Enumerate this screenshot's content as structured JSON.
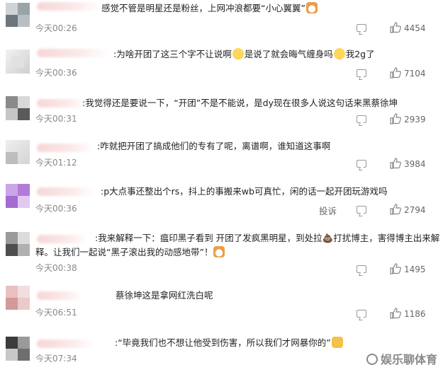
{
  "comments": [
    {
      "text": "感觉不管是明星还是粉丝，上网冲浪都要“小心翼翼”",
      "emoji_after": "cat",
      "time": "今天00:26",
      "likes": "4454"
    },
    {
      "text_parts": [
        ":为啥开团了这三个字不让说啊",
        "是说了就会晦气缠身吗",
        "我2g了"
      ],
      "time": "今天00:36",
      "likes": "7104"
    },
    {
      "text": ":我觉得还是要说一下，“开团”不是不能说，是dy现在很多人说这句话来黑蔡徐坤",
      "time": "今天00:31",
      "likes": "2939"
    },
    {
      "text": ":咋就把开团了搞成他们的专有了呢，离谱啊，谁知道这事啊",
      "time": "今天01:12",
      "likes": "3984"
    },
    {
      "text": ":p大点事还整出个rs，抖上的事搬来wb可真忙，闲的话一起开团玩游戏吗",
      "time": "今天00:36",
      "report": "投诉",
      "likes": "2794"
    },
    {
      "line1": ":我来解释一下：瘟印黑子看到 开团了发疯黑明星，到处拉💩打扰博主，害得博主出来解",
      "line2": "释。让我们一起说“黑子滚出我的动感地带”！",
      "time": "今天00:38",
      "likes": "1495"
    },
    {
      "text": "蔡徐坤这是拿网红洗白呢",
      "time": "今天06:51",
      "likes": "1186"
    },
    {
      "text": ":“毕竟我们也不想让他受到伤害，所以我们才网暴你的”",
      "emoji_after": "thumb",
      "time": "今天07:34"
    }
  ],
  "watermark": "娱乐聊体育",
  "icons": {
    "reply": "reply-icon",
    "like": "thumbs-up-icon"
  }
}
